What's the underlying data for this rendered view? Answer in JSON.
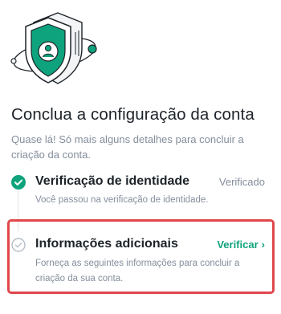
{
  "page": {
    "title": "Conclua a configuração da conta",
    "subtitle": "Quase lá! Só mais alguns detalhes para concluir a criação da conta."
  },
  "steps": [
    {
      "title": "Verificação de identidade",
      "status": "Verificado",
      "description": "Você passou na verificação de identidade.",
      "state": "completed",
      "icon": "check-circle-icon"
    },
    {
      "title": "Informações adicionais",
      "action": "Verificar",
      "description": "Forneça as seguintes informações para concluir a criação da sua conta.",
      "state": "pending",
      "icon": "check-outline-icon"
    }
  ],
  "colors": {
    "accent": "#0ea37c",
    "highlight_border": "#e0474b",
    "text_primary": "#1e2329",
    "text_secondary": "#848e9c"
  }
}
